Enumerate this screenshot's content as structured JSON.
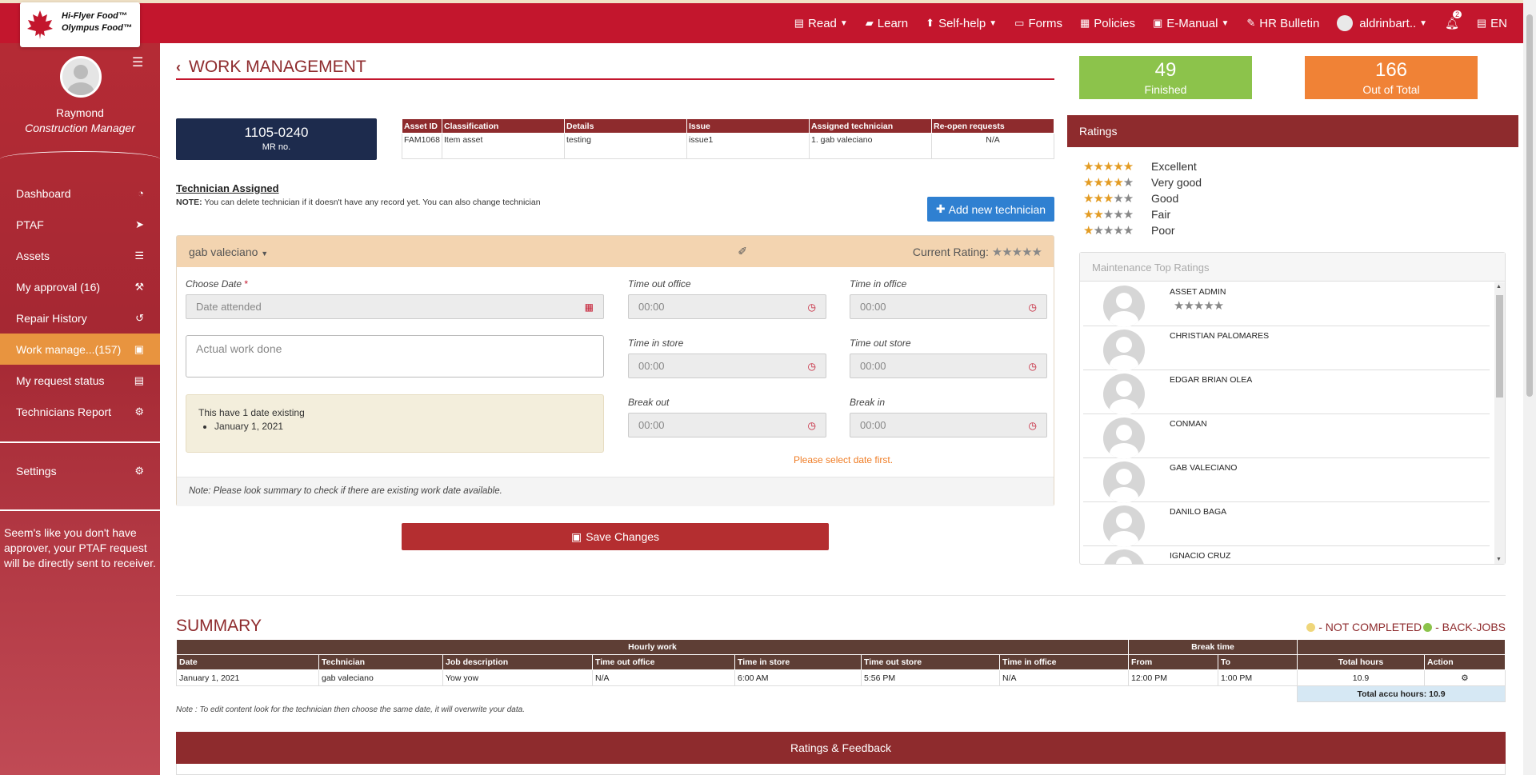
{
  "brand": {
    "line1": "Hi-Flyer Food™",
    "line2": "Olympus Food™"
  },
  "nav": {
    "read": "Read",
    "learn": "Learn",
    "selfhelp": "Self-help",
    "forms": "Forms",
    "policies": "Policies",
    "emanual": "E-Manual",
    "hrbulletin": "HR Bulletin",
    "user": "aldrinbart..",
    "notif_count": "2",
    "lang": "EN"
  },
  "sidebar": {
    "name": "Raymond",
    "role": "Construction Manager",
    "items": [
      {
        "label": "Dashboard",
        "icon": "dashboard-icon",
        "glyph": "◔"
      },
      {
        "label": "PTAF",
        "icon": "paper-plane-icon",
        "glyph": "➤"
      },
      {
        "label": "Assets",
        "icon": "list-icon",
        "glyph": "☰"
      },
      {
        "label": "My approval (16)",
        "icon": "gavel-icon",
        "glyph": "⚒"
      },
      {
        "label": "Repair History",
        "icon": "history-icon",
        "glyph": "↺"
      },
      {
        "label": "Work manage...(157)",
        "icon": "calendar-check-icon",
        "glyph": "▣"
      },
      {
        "label": "My request status",
        "icon": "file-icon",
        "glyph": "▤"
      },
      {
        "label": "Technicians Report",
        "icon": "cogs-icon",
        "glyph": "⚙"
      }
    ],
    "settings": "Settings",
    "note": "Seem's like you don't have approver, your PTAF request will be directly sent to receiver."
  },
  "page": {
    "title": "WORK MANAGEMENT"
  },
  "stats": {
    "finished": {
      "num": "49",
      "label": "Finished"
    },
    "total": {
      "num": "166",
      "label": "Out of Total"
    }
  },
  "mr": {
    "number": "1105-0240",
    "label": "MR no."
  },
  "asset_table": {
    "headers": [
      "Asset ID",
      "Classification",
      "Details",
      "Issue",
      "Assigned technician",
      "Re-open requests"
    ],
    "row": [
      "FAM1068",
      "Item asset",
      "testing",
      "issue1",
      "1. gab valeciano",
      "N/A"
    ]
  },
  "technician": {
    "title": "Technician Assigned",
    "note_bold": "NOTE:",
    "note": " You can delete technician if it doesn't have any record yet. You can also change technician",
    "add_label": "Add new technician",
    "selected": "gab valeciano",
    "current_rating_label": "Current Rating:",
    "current_rating_stars": "★★★★★"
  },
  "form": {
    "choose_date_label": "Choose Date",
    "date_placeholder": "Date attended",
    "work_done_placeholder": "Actual work done",
    "time_out_office": "Time out office",
    "time_in_office": "Time in office",
    "time_in_store": "Time in store",
    "time_out_store": "Time out store",
    "break_out": "Break out",
    "break_in": "Break in",
    "time_placeholder": "00:00",
    "existing_title": "This have 1 date existing",
    "existing_dates": [
      "January 1, 2021"
    ],
    "select_date_msg": "Please select date first.",
    "footer_note": "Note: Please look summary to check if there are existing work date available.",
    "save_label": "Save Changes"
  },
  "ratings": {
    "title": "Ratings",
    "legend": [
      {
        "label": "Excellent",
        "filled": "★★★★★",
        "empty": ""
      },
      {
        "label": "Very good",
        "filled": "★★★★",
        "empty": "★"
      },
      {
        "label": "Good",
        "filled": "★★★",
        "empty": "★★"
      },
      {
        "label": "Fair",
        "filled": "★★",
        "empty": "★★★"
      },
      {
        "label": "Poor",
        "filled": "★",
        "empty": "★★★★"
      }
    ],
    "top_title": "Maintenance Top Ratings",
    "top_list": [
      {
        "name": "ASSET ADMIN",
        "stars": "★★★★★"
      },
      {
        "name": "CHRISTIAN PALOMARES",
        "stars": ""
      },
      {
        "name": "EDGAR BRIAN OLEA",
        "stars": ""
      },
      {
        "name": "CONMAN",
        "stars": ""
      },
      {
        "name": "GAB VALECIANO",
        "stars": ""
      },
      {
        "name": "DANILO BAGA",
        "stars": ""
      },
      {
        "name": "IGNACIO CRUZ",
        "stars": ""
      }
    ]
  },
  "summary": {
    "title": "SUMMARY",
    "legend_not_completed": "- NOT COMPLETED",
    "legend_backjobs": "- BACK-JOBS",
    "group_hourly": "Hourly work",
    "group_break": "Break time",
    "headers": [
      "Date",
      "Technician",
      "Job description",
      "Time out office",
      "Time in store",
      "Time out store",
      "Time in office",
      "From",
      "To",
      "Total hours",
      "Action"
    ],
    "row": [
      "January 1, 2021",
      "gab valeciano",
      "Yow yow",
      "N/A",
      "6:00 AM",
      "5:56 PM",
      "N/A",
      "12:00 PM",
      "1:00 PM",
      "10.9"
    ],
    "total_label": "Total accu hours: 10.9",
    "note": "Note : To edit content look for the technician then choose the same date, it will overwrite your data."
  },
  "feedback": {
    "title": "Ratings & Feedback"
  },
  "colors": {
    "brand_red": "#c3162d",
    "maroon": "#8e2b2d",
    "green": "#8cc34b",
    "orange": "#f08236",
    "navy": "#1d2b4d",
    "not_completed": "#efd67a",
    "backjobs": "#8cc34b"
  }
}
